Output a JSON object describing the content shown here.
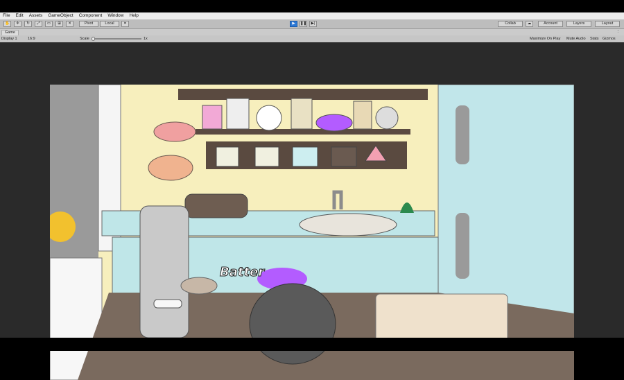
{
  "menu": [
    "File",
    "Edit",
    "Assets",
    "GameObject",
    "Component",
    "Window",
    "Help"
  ],
  "toolbar": {
    "pivot": "Pivot",
    "local": "Local",
    "collab": "Collab",
    "account": "Account",
    "layers": "Layers",
    "layout": "Layout"
  },
  "tab": {
    "game": "Game"
  },
  "gamebar": {
    "display": "Display 1",
    "aspect": "16:9",
    "scale_label": "Scale",
    "scale_value": "1x",
    "maximize": "Maximize On Play",
    "mute": "Mute Audio",
    "stats": "Stats",
    "gizmos": "Gizmos"
  },
  "scene": {
    "batter_label": "Batter"
  },
  "colors": {
    "accent": "#2d79d6",
    "wall": "#f7efbd",
    "cabinet": "#bfe6e8",
    "counter": "#6d5c4f",
    "potion": "#b35cff"
  }
}
